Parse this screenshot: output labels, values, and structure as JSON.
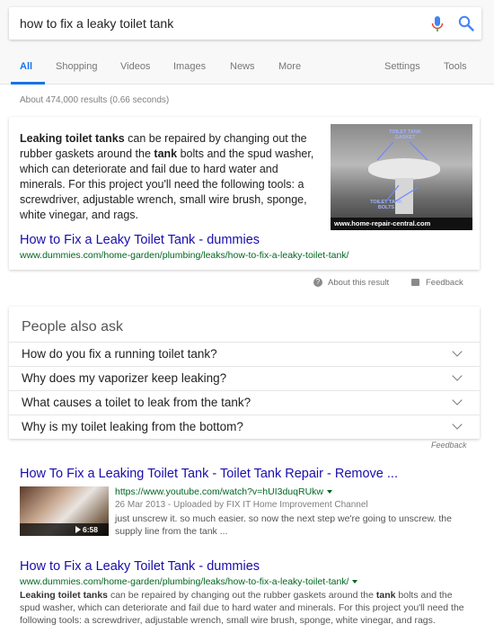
{
  "search": {
    "query": "how to fix a leaky toilet tank"
  },
  "tabs": [
    "All",
    "Shopping",
    "Videos",
    "Images",
    "News",
    "More"
  ],
  "tools": {
    "settings": "Settings",
    "tools": "Tools"
  },
  "stats": "About 474,000 results (0.66 seconds)",
  "featured": {
    "text_part1_bold": "Leaking toilet tanks",
    "text_part2": " can be repaired by changing out the rubber gaskets around the ",
    "text_part3_bold": "tank",
    "text_part4": " bolts and the spud washer, which can deteriorate and fail due to hard water and minerals. For this project you'll need the following tools: a screwdriver, adjustable wrench, small wire brush, sponge, white vinegar, and rags.",
    "image_caption": "www.home-repair-central.com",
    "image_label_top": "TOILET TANK GASKET",
    "image_label_bottom": "TOILET TANK BOLTS",
    "title": "How to Fix a Leaky Toilet Tank - dummies",
    "url": "www.dummies.com/home-garden/plumbing/leaks/how-to-fix-a-leaky-toilet-tank/"
  },
  "about": {
    "about_label": "About this result",
    "feedback_label": "Feedback"
  },
  "paa": {
    "title": "People also ask",
    "questions": [
      "How do you fix a running toilet tank?",
      "Why does my vaporizer keep leaking?",
      "What causes a toilet to leak from the tank?",
      "Why is my toilet leaking from the bottom?"
    ],
    "feedback": "Feedback"
  },
  "result1": {
    "title": "How To Fix a Leaking Toilet Tank - Toilet Tank Repair - Remove ...",
    "url": "https://www.youtube.com/watch?v=hUI3duqRUkw",
    "meta": "26 Mar 2013 - Uploaded by FIX IT Home Improvement Channel",
    "text": "just unscrew it. so much easier. so now the next step we're going to unscrew. the supply line from the tank ...",
    "duration": "6:58"
  },
  "result2": {
    "title": "How to Fix a Leaky Toilet Tank - dummies",
    "url": "www.dummies.com/home-garden/plumbing/leaks/how-to-fix-a-leaky-toilet-tank/",
    "text_part1_bold": "Leaking toilet tanks",
    "text_part2": " can be repaired by changing out the rubber gaskets around the ",
    "text_part3_bold": "tank",
    "text_part4": " bolts and the spud washer, which can deteriorate and fail due to hard water and minerals. For this project you'll need the following tools: a screwdriver, adjustable wrench, small wire brush, sponge, white vinegar, and rags."
  },
  "colors": {
    "link": "#1a0dab",
    "url": "#006621",
    "active_tab": "#1a73e8"
  }
}
